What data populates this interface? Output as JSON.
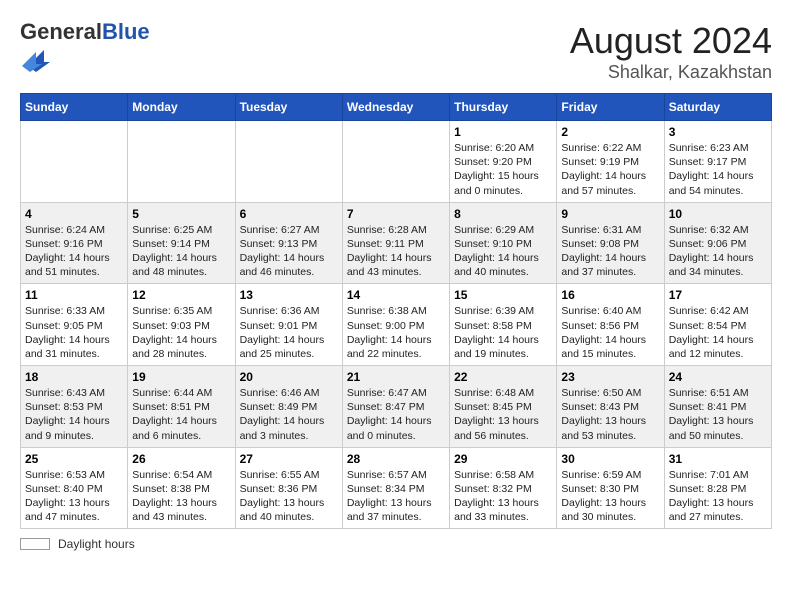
{
  "header": {
    "logo_general": "General",
    "logo_blue": "Blue",
    "month": "August 2024",
    "location": "Shalkar, Kazakhstan"
  },
  "calendar": {
    "days_of_week": [
      "Sunday",
      "Monday",
      "Tuesday",
      "Wednesday",
      "Thursday",
      "Friday",
      "Saturday"
    ],
    "weeks": [
      [
        {
          "day": "",
          "info": ""
        },
        {
          "day": "",
          "info": ""
        },
        {
          "day": "",
          "info": ""
        },
        {
          "day": "",
          "info": ""
        },
        {
          "day": "1",
          "info": "Sunrise: 6:20 AM\nSunset: 9:20 PM\nDaylight: 15 hours\nand 0 minutes."
        },
        {
          "day": "2",
          "info": "Sunrise: 6:22 AM\nSunset: 9:19 PM\nDaylight: 14 hours\nand 57 minutes."
        },
        {
          "day": "3",
          "info": "Sunrise: 6:23 AM\nSunset: 9:17 PM\nDaylight: 14 hours\nand 54 minutes."
        }
      ],
      [
        {
          "day": "4",
          "info": "Sunrise: 6:24 AM\nSunset: 9:16 PM\nDaylight: 14 hours\nand 51 minutes."
        },
        {
          "day": "5",
          "info": "Sunrise: 6:25 AM\nSunset: 9:14 PM\nDaylight: 14 hours\nand 48 minutes."
        },
        {
          "day": "6",
          "info": "Sunrise: 6:27 AM\nSunset: 9:13 PM\nDaylight: 14 hours\nand 46 minutes."
        },
        {
          "day": "7",
          "info": "Sunrise: 6:28 AM\nSunset: 9:11 PM\nDaylight: 14 hours\nand 43 minutes."
        },
        {
          "day": "8",
          "info": "Sunrise: 6:29 AM\nSunset: 9:10 PM\nDaylight: 14 hours\nand 40 minutes."
        },
        {
          "day": "9",
          "info": "Sunrise: 6:31 AM\nSunset: 9:08 PM\nDaylight: 14 hours\nand 37 minutes."
        },
        {
          "day": "10",
          "info": "Sunrise: 6:32 AM\nSunset: 9:06 PM\nDaylight: 14 hours\nand 34 minutes."
        }
      ],
      [
        {
          "day": "11",
          "info": "Sunrise: 6:33 AM\nSunset: 9:05 PM\nDaylight: 14 hours\nand 31 minutes."
        },
        {
          "day": "12",
          "info": "Sunrise: 6:35 AM\nSunset: 9:03 PM\nDaylight: 14 hours\nand 28 minutes."
        },
        {
          "day": "13",
          "info": "Sunrise: 6:36 AM\nSunset: 9:01 PM\nDaylight: 14 hours\nand 25 minutes."
        },
        {
          "day": "14",
          "info": "Sunrise: 6:38 AM\nSunset: 9:00 PM\nDaylight: 14 hours\nand 22 minutes."
        },
        {
          "day": "15",
          "info": "Sunrise: 6:39 AM\nSunset: 8:58 PM\nDaylight: 14 hours\nand 19 minutes."
        },
        {
          "day": "16",
          "info": "Sunrise: 6:40 AM\nSunset: 8:56 PM\nDaylight: 14 hours\nand 15 minutes."
        },
        {
          "day": "17",
          "info": "Sunrise: 6:42 AM\nSunset: 8:54 PM\nDaylight: 14 hours\nand 12 minutes."
        }
      ],
      [
        {
          "day": "18",
          "info": "Sunrise: 6:43 AM\nSunset: 8:53 PM\nDaylight: 14 hours\nand 9 minutes."
        },
        {
          "day": "19",
          "info": "Sunrise: 6:44 AM\nSunset: 8:51 PM\nDaylight: 14 hours\nand 6 minutes."
        },
        {
          "day": "20",
          "info": "Sunrise: 6:46 AM\nSunset: 8:49 PM\nDaylight: 14 hours\nand 3 minutes."
        },
        {
          "day": "21",
          "info": "Sunrise: 6:47 AM\nSunset: 8:47 PM\nDaylight: 14 hours\nand 0 minutes."
        },
        {
          "day": "22",
          "info": "Sunrise: 6:48 AM\nSunset: 8:45 PM\nDaylight: 13 hours\nand 56 minutes."
        },
        {
          "day": "23",
          "info": "Sunrise: 6:50 AM\nSunset: 8:43 PM\nDaylight: 13 hours\nand 53 minutes."
        },
        {
          "day": "24",
          "info": "Sunrise: 6:51 AM\nSunset: 8:41 PM\nDaylight: 13 hours\nand 50 minutes."
        }
      ],
      [
        {
          "day": "25",
          "info": "Sunrise: 6:53 AM\nSunset: 8:40 PM\nDaylight: 13 hours\nand 47 minutes."
        },
        {
          "day": "26",
          "info": "Sunrise: 6:54 AM\nSunset: 8:38 PM\nDaylight: 13 hours\nand 43 minutes."
        },
        {
          "day": "27",
          "info": "Sunrise: 6:55 AM\nSunset: 8:36 PM\nDaylight: 13 hours\nand 40 minutes."
        },
        {
          "day": "28",
          "info": "Sunrise: 6:57 AM\nSunset: 8:34 PM\nDaylight: 13 hours\nand 37 minutes."
        },
        {
          "day": "29",
          "info": "Sunrise: 6:58 AM\nSunset: 8:32 PM\nDaylight: 13 hours\nand 33 minutes."
        },
        {
          "day": "30",
          "info": "Sunrise: 6:59 AM\nSunset: 8:30 PM\nDaylight: 13 hours\nand 30 minutes."
        },
        {
          "day": "31",
          "info": "Sunrise: 7:01 AM\nSunset: 8:28 PM\nDaylight: 13 hours\nand 27 minutes."
        }
      ]
    ]
  },
  "footer": {
    "label": "Daylight hours"
  }
}
